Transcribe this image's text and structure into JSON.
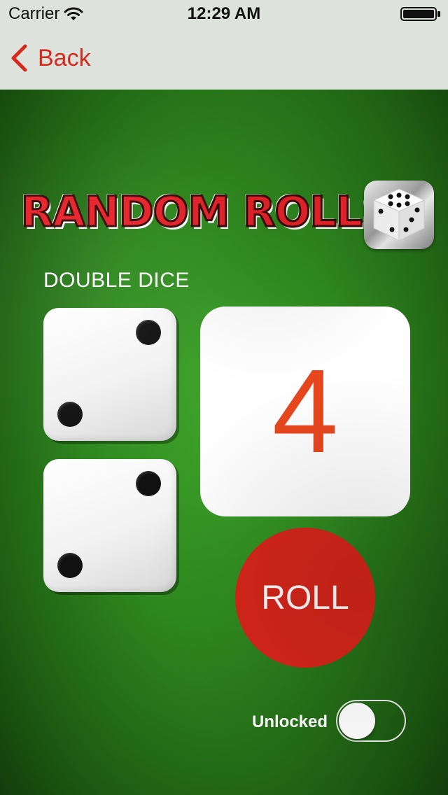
{
  "status_bar": {
    "carrier": "Carrier",
    "time": "12:29 AM"
  },
  "nav": {
    "back_label": "Back"
  },
  "logo": {
    "text": "RANDOM ROLLS"
  },
  "game": {
    "mode_label": "DOUBLE DICE",
    "dice": [
      2,
      2
    ],
    "result": "4",
    "roll_label": "ROLL"
  },
  "toggle": {
    "label": "Unlocked",
    "on": false
  },
  "colors": {
    "accent_red": "#d8261a",
    "result_orange": "#e8471e",
    "felt_green": "#2f8a1f"
  },
  "icons": [
    "wifi-icon",
    "battery-icon",
    "chevron-left-icon",
    "dice-app-icon"
  ]
}
